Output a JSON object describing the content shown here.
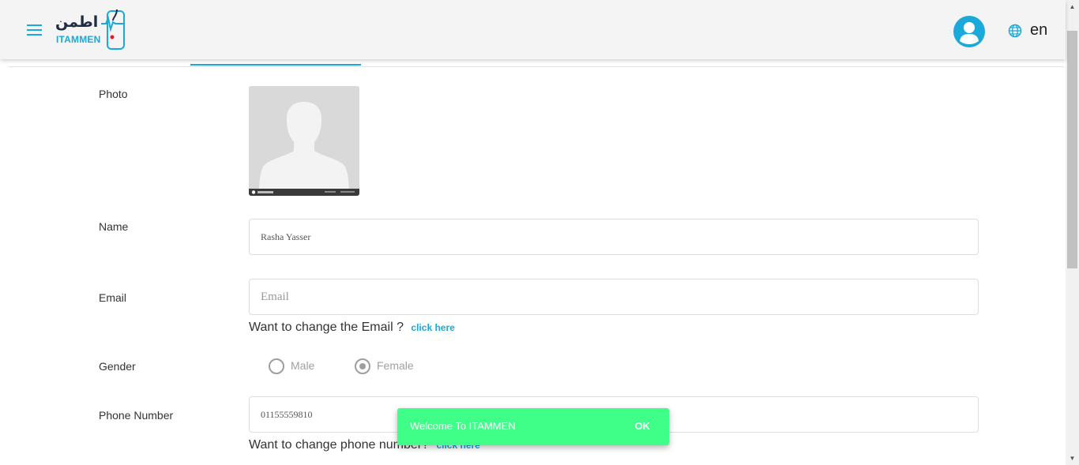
{
  "header": {
    "logo_arabic": "اطمن",
    "logo_english": "ITAMMEN",
    "language": "en"
  },
  "form": {
    "photo_label": "Photo",
    "name_label": "Name",
    "name_value": "Rasha Yasser",
    "email_label": "Email",
    "email_placeholder": "Email",
    "email_help": "Want to change the Email ?",
    "email_link": "click here",
    "gender_label": "Gender",
    "gender_male": "Male",
    "gender_female": "Female",
    "gender_selected": "Female",
    "phone_label": "Phone Number",
    "phone_value": "01155559810",
    "phone_help": "Want to change phone number?",
    "phone_link": "click here"
  },
  "toast": {
    "message": "Welcome To ITAMMEN",
    "action": "OK",
    "color": "#40ff88"
  },
  "colors": {
    "accent": "#1aa9d8"
  },
  "icons": [
    "menu-icon",
    "user-icon",
    "globe-icon",
    "stethoscope-phone-icon",
    "person-silhouette-icon"
  ]
}
